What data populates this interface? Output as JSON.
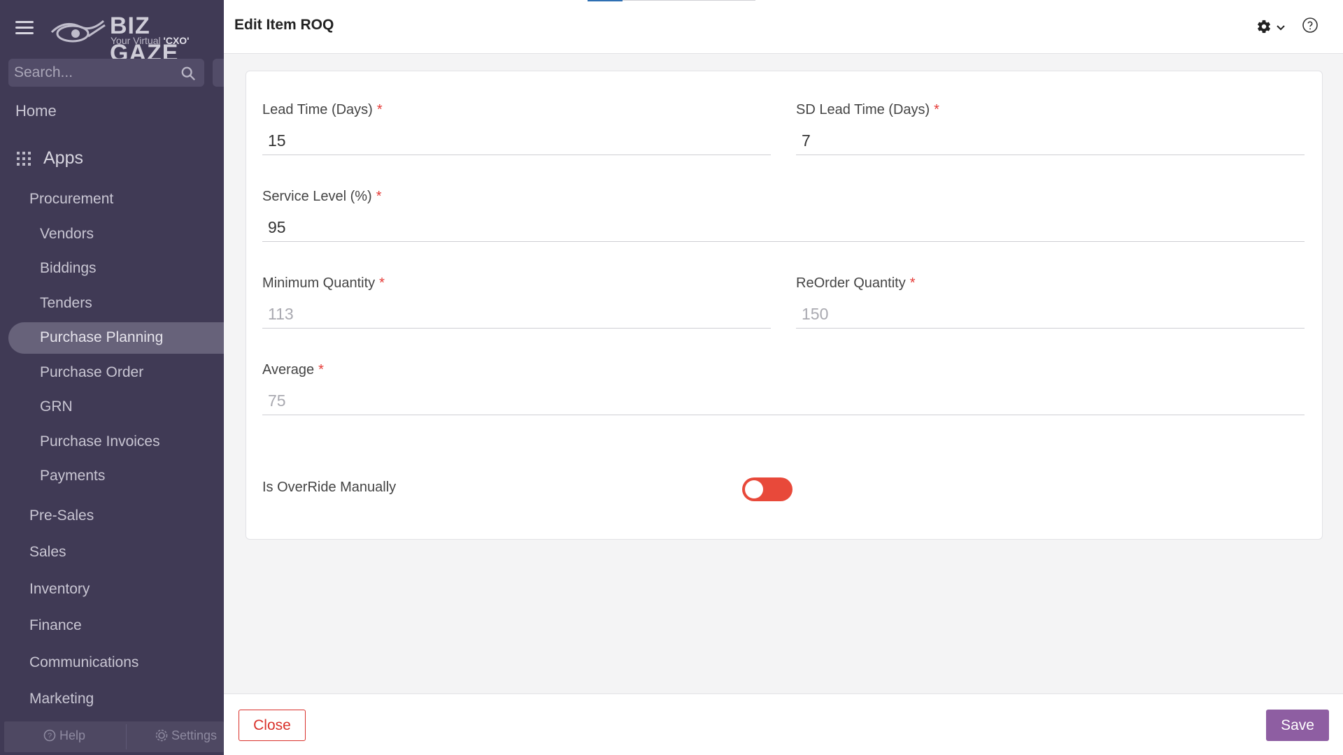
{
  "brand": {
    "name": "BIZ GAZE",
    "tagline_prefix": "Your Virtual ",
    "tagline_strong": "'CXO'",
    "trademark": "™"
  },
  "sidebar": {
    "search_placeholder": "Search...",
    "home": "Home",
    "apps": "Apps",
    "procurement": "Procurement",
    "procurement_items": [
      "Vendors",
      "Biddings",
      "Tenders",
      "Purchase Planning",
      "Purchase Order",
      "GRN",
      "Purchase Invoices",
      "Payments"
    ],
    "active_item": "Purchase Planning",
    "categories": [
      "Pre-Sales",
      "Sales",
      "Inventory",
      "Finance",
      "Communications",
      "Marketing"
    ],
    "footer": {
      "help": "Help",
      "settings": "Settings"
    }
  },
  "modal": {
    "title": "Edit Item ROQ",
    "fields": {
      "lead_time": {
        "label": "Lead Time (Days)",
        "value": "15"
      },
      "sd_lead_time": {
        "label": "SD Lead Time (Days)",
        "value": "7"
      },
      "service_level": {
        "label": "Service Level (%)",
        "value": "95"
      },
      "minimum_quantity": {
        "label": "Minimum Quantity",
        "value": "113"
      },
      "reorder_quantity": {
        "label": "ReOrder Quantity",
        "value": "150"
      },
      "average": {
        "label": "Average",
        "value": "75"
      }
    },
    "required_mark": "*",
    "override": {
      "label": "Is OverRide Manually",
      "checked": false
    },
    "close_label": "Close",
    "save_label": "Save"
  },
  "colors": {
    "sidebar_bg": "#403a55",
    "toggle_off": "#e8493a",
    "close": "#d9312b",
    "save": "#8e5ea2",
    "required": "#e53935"
  }
}
